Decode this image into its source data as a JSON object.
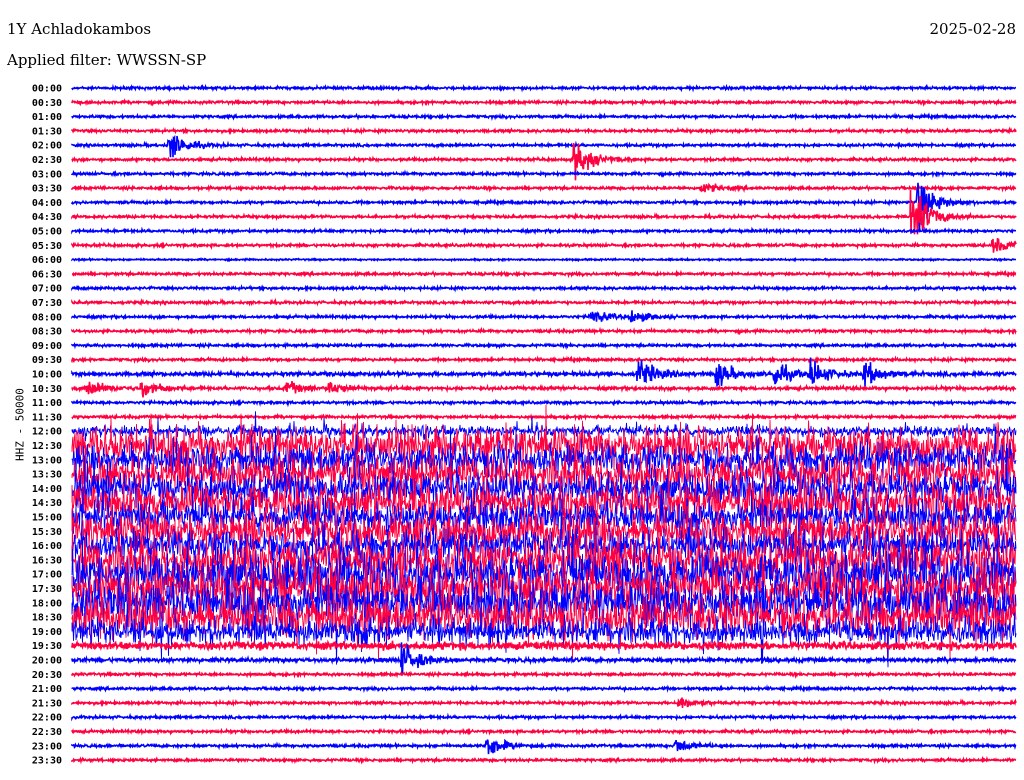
{
  "header": {
    "title": "1Y Achladokambos",
    "filter": "Applied filter: WWSSN-SP",
    "date": "2025-02-28"
  },
  "chart_data": {
    "type": "line",
    "title": "1Y Achladokambos",
    "subtitle": "Applied filter: WWSSN-SP",
    "ylabel": "HHZ - 50000",
    "xlabel": "",
    "x_range_minutes_per_line": 30,
    "colors": {
      "even": "#0000ff",
      "odd": "#ff0040"
    },
    "rows": [
      "00:00",
      "00:30",
      "01:00",
      "01:30",
      "02:00",
      "02:30",
      "03:00",
      "03:30",
      "04:00",
      "04:30",
      "05:00",
      "05:30",
      "06:00",
      "06:30",
      "07:00",
      "07:30",
      "08:00",
      "08:30",
      "09:00",
      "09:30",
      "10:00",
      "10:30",
      "11:00",
      "11:30",
      "12:00",
      "12:30",
      "13:00",
      "13:30",
      "14:00",
      "14:30",
      "15:00",
      "15:30",
      "16:00",
      "16:30",
      "17:00",
      "17:30",
      "18:00",
      "18:30",
      "19:00",
      "19:30",
      "20:00",
      "20:30",
      "21:00",
      "21:30",
      "22:00",
      "22:30",
      "23:00",
      "23:30"
    ],
    "noise_level": [
      1,
      1,
      1,
      1,
      1,
      1,
      1,
      1,
      1,
      1,
      1,
      1,
      0.6,
      1,
      1,
      1,
      1,
      1,
      1,
      1,
      1.5,
      1.2,
      1,
      1,
      4,
      14,
      12,
      14,
      12,
      14,
      12,
      14,
      12,
      16,
      16,
      16,
      16,
      16,
      10,
      3,
      1.5,
      1,
      1,
      1,
      1,
      1,
      1,
      1
    ],
    "events": [
      {
        "row": "02:00",
        "minute": 3.1,
        "amplitude": 12
      },
      {
        "row": "02:30",
        "minute": 16.0,
        "amplitude": 16
      },
      {
        "row": "03:30",
        "minute": 20.0,
        "amplitude": 4
      },
      {
        "row": "04:00",
        "minute": 26.9,
        "amplitude": 22
      },
      {
        "row": "04:30",
        "minute": 26.7,
        "amplitude": 30
      },
      {
        "row": "05:30",
        "minute": 29.3,
        "amplitude": 6
      },
      {
        "row": "08:00",
        "minute": 16.5,
        "amplitude": 6
      },
      {
        "row": "08:00",
        "minute": 17.8,
        "amplitude": 5
      },
      {
        "row": "10:00",
        "minute": 18.0,
        "amplitude": 12
      },
      {
        "row": "10:00",
        "minute": 20.5,
        "amplitude": 10
      },
      {
        "row": "10:00",
        "minute": 22.3,
        "amplitude": 10
      },
      {
        "row": "10:00",
        "minute": 23.5,
        "amplitude": 10
      },
      {
        "row": "10:00",
        "minute": 25.2,
        "amplitude": 10
      },
      {
        "row": "10:30",
        "minute": 0.5,
        "amplitude": 8
      },
      {
        "row": "10:30",
        "minute": 2.2,
        "amplitude": 8
      },
      {
        "row": "10:30",
        "minute": 6.8,
        "amplitude": 6
      },
      {
        "row": "10:30",
        "minute": 8.2,
        "amplitude": 5
      },
      {
        "row": "20:00",
        "minute": 10.5,
        "amplitude": 14
      },
      {
        "row": "21:30",
        "minute": 19.3,
        "amplitude": 5
      },
      {
        "row": "23:00",
        "minute": 13.2,
        "amplitude": 10
      },
      {
        "row": "23:00",
        "minute": 19.2,
        "amplitude": 6
      }
    ]
  }
}
